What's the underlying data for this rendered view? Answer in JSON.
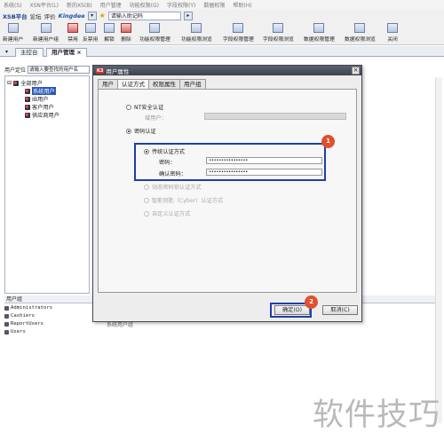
{
  "menubar": {
    "items": [
      "系统(S)",
      "XSN平台(L)",
      "新的XS(B)",
      "用户管理",
      "功能权限(G)",
      "字段权限(Y)",
      "数据权限",
      "帮助(H)"
    ]
  },
  "addressbar": {
    "brand": "XSB平台",
    "links": [
      "论坛",
      "评价"
    ],
    "logo": "Kingdee",
    "input_value": "请输入助记码",
    "go_label": "▸"
  },
  "toolbar": {
    "buttons": [
      "新建用户",
      "新建用户组",
      "禁用",
      "反禁用",
      "解锁",
      "删除",
      "功能权限管理",
      "功能权限浏览",
      "字段权限管理",
      "字段权限浏览",
      "数据权限管理",
      "数据权限浏览",
      "关闭"
    ]
  },
  "tabs": [
    "主控台",
    "用户管理"
  ],
  "tab_close": "×",
  "left": {
    "search_label": "用户定位",
    "search_value": "请输入要查找的用户名",
    "tree_root": "全部用户",
    "tree_children": [
      "系统用户",
      "IB用户",
      "客户用户",
      "供应商用户"
    ]
  },
  "groups": {
    "header": "用户组",
    "items": [
      "Administrators",
      "Cashiers",
      "ReportUsers",
      "Users"
    ]
  },
  "filler": "系统用户组",
  "dialog": {
    "title": "用户属性",
    "logo": "K3",
    "close": "×",
    "tabs": [
      "用户",
      "认证方式",
      "权限属性",
      "用户组"
    ],
    "nt_auth": "NT安全认证",
    "domain_user_label": "域用户：",
    "password_auth": "密码认证",
    "traditional_auth": "传统认证方式",
    "password_label": "密码：",
    "password_value": "••••••••••••••••",
    "confirm_label": "确认密码：",
    "confirm_value": "••••••••••••••••",
    "dynamic_auth": "动态密码锁认证方式",
    "smartcard_auth": "智能钥匙（Cyber）认证方式",
    "custom_auth": "自定义认证方式",
    "ok": "确定(O)",
    "cancel": "取消(C)"
  },
  "annotations": {
    "badge1": "1",
    "badge2": "2"
  },
  "watermark": "软件技巧"
}
